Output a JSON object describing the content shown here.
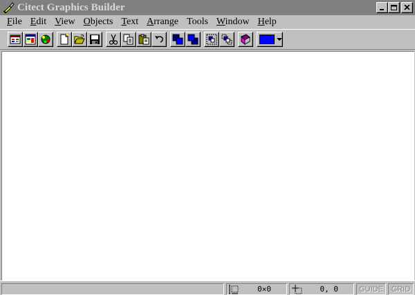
{
  "window": {
    "title": "Citect Graphics Builder",
    "buttons": {
      "minimize": "_",
      "maximize": "□",
      "close": "✕"
    }
  },
  "menu": [
    {
      "label": "File",
      "mnemonic": "F"
    },
    {
      "label": "Edit",
      "mnemonic": "E"
    },
    {
      "label": "View",
      "mnemonic": "V"
    },
    {
      "label": "Objects",
      "mnemonic": "O"
    },
    {
      "label": "Text",
      "mnemonic": "T"
    },
    {
      "label": "Arrange",
      "mnemonic": "A"
    },
    {
      "label": "Tools",
      "mnemonic": ""
    },
    {
      "label": "Window",
      "mnemonic": "W"
    },
    {
      "label": "Help",
      "mnemonic": "H"
    }
  ],
  "toolbar": {
    "groups": [
      [
        "project-editor-icon",
        "page-editor-icon",
        "compile-icon"
      ],
      [
        "new-icon",
        "open-icon",
        "save-icon"
      ],
      [
        "cut-icon",
        "copy-icon",
        "paste-icon",
        "undo-icon"
      ],
      [
        "bring-to-front-icon",
        "send-to-back-icon"
      ],
      [
        "group-icon",
        "ungroup-icon"
      ],
      [
        "help-book-icon"
      ]
    ],
    "fill_color": "#0000ff"
  },
  "status": {
    "message": "",
    "size": "0×0",
    "position": "0, 0",
    "guide": "GUIDE",
    "grid": "GRID"
  },
  "colors": {
    "face": "#c0c0c0",
    "titlebar_inactive": "#808080",
    "canvas": "#ffffff"
  }
}
